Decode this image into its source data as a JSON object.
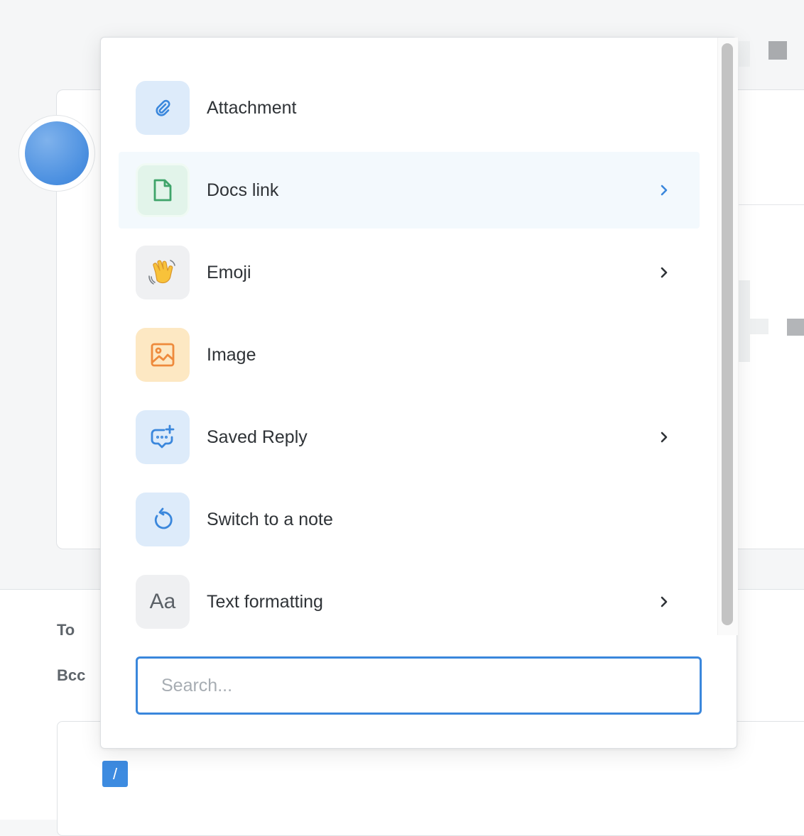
{
  "menu": {
    "items": [
      {
        "label": "Attachment",
        "icon": "paperclip-icon",
        "has_submenu": false
      },
      {
        "label": "Docs link",
        "icon": "document-icon",
        "has_submenu": true,
        "highlighted": true
      },
      {
        "label": "Emoji",
        "icon": "waving-hand-icon",
        "has_submenu": true
      },
      {
        "label": "Image",
        "icon": "image-icon",
        "has_submenu": false
      },
      {
        "label": "Saved Reply",
        "icon": "chat-bubble-plus-icon",
        "has_submenu": true
      },
      {
        "label": "Switch to a note",
        "icon": "rotate-left-icon",
        "has_submenu": false
      },
      {
        "label": "Text formatting",
        "icon": "text-aa-icon",
        "icon_text": "Aa",
        "has_submenu": true
      }
    ],
    "search": {
      "placeholder": "Search...",
      "value": ""
    }
  },
  "composer": {
    "to_label": "To",
    "bcc_label": "Bcc",
    "slash_trigger": "/"
  },
  "colors": {
    "accent_blue": "#3a87dc",
    "highlight_row": "#f3f9fd",
    "tile_blue": "#ddebfa",
    "tile_green": "#e2f4ea",
    "tile_orange": "#fde8c3",
    "tile_gray": "#eff0f2"
  }
}
